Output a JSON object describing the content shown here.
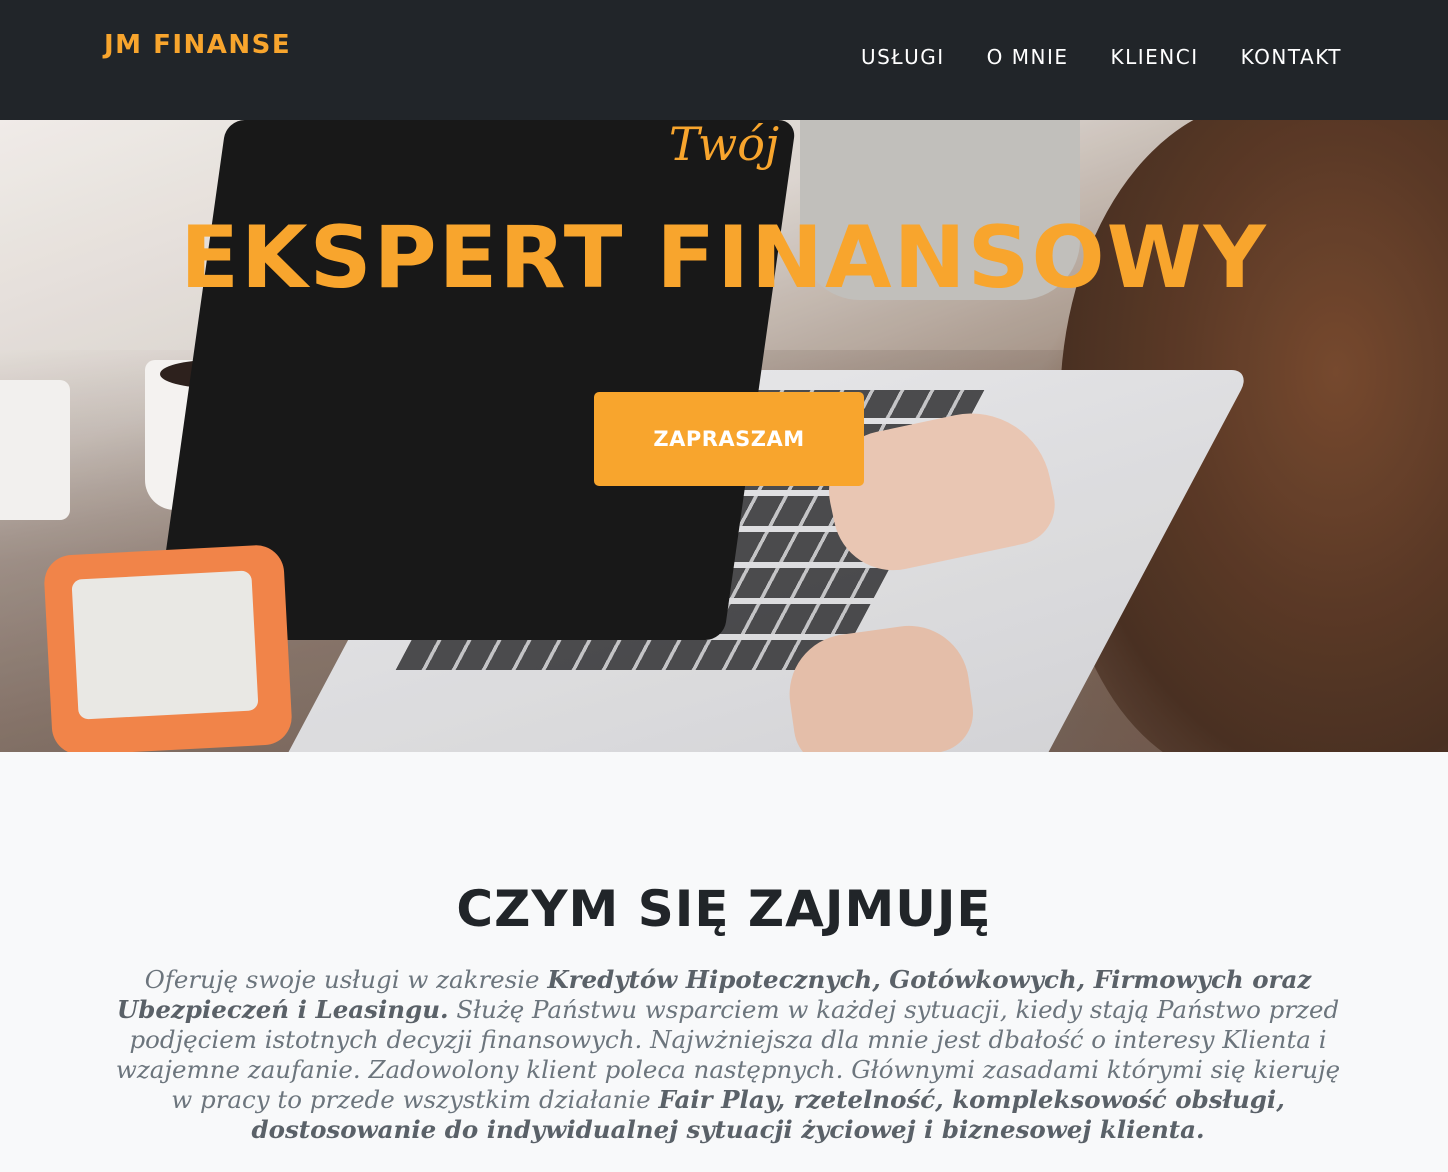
{
  "navbar": {
    "brand": "JM FINANSE",
    "links": [
      "USŁUGI",
      "O MNIE",
      "KLIENCI",
      "KONTAKT"
    ]
  },
  "hero": {
    "subheading": "Twój",
    "heading": "EKSPERT FINANSOWY",
    "cta_label": "ZAPRASZAM"
  },
  "services": {
    "title": "CZYM SIĘ ZAJMUJĘ",
    "text": [
      {
        "t": "Oferuję swoje usługi w zakresie ",
        "b": false
      },
      {
        "t": "Kredytów Hipotecznych, Gotówkowych, Firmowych oraz Ubezpieczeń i Leasingu.",
        "b": true
      },
      {
        "t": " Służę Państwu wsparciem w każdej sytuacji, kiedy stają Państwo przed podjęciem istotnych decyzji finansowych. Najwżniejsza dla mnie jest dbałość o interesy Klienta i wzajemne zaufanie. Zadowolony klient poleca następnych. Głównymi zasadami którymi się kieruję w pracy to przede wszystkim działanie ",
        "b": false
      },
      {
        "t": "Fair Play, rzetelność, kompleksowość obsługi, dostosowanie do indywidualnej sytuacji życiowej i biznesowej klienta.",
        "b": true
      }
    ]
  },
  "colors": {
    "accent": "#f8a52d",
    "navbar_bg": "#212529",
    "section_bg": "#f8f9fa",
    "heading_dark": "#212529",
    "muted_text": "#6c757d"
  }
}
